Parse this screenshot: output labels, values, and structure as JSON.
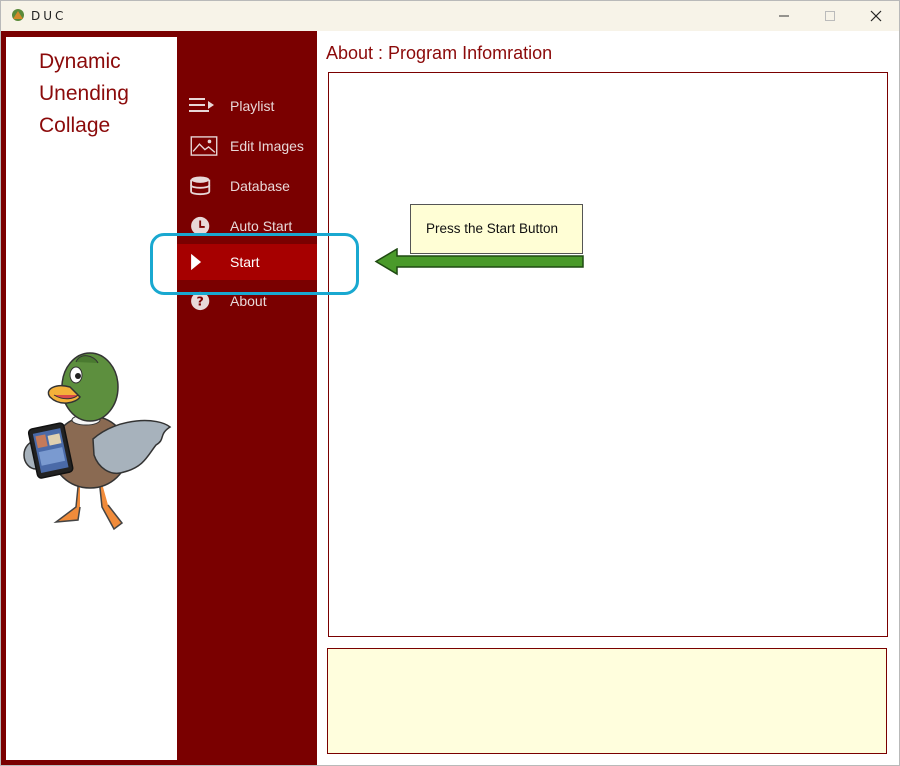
{
  "window": {
    "title": "DUC",
    "controls": {
      "minimize": "minimize-icon",
      "maximize": "maximize-icon",
      "close": "close-icon"
    }
  },
  "brand": {
    "line1": "Dynamic",
    "line2": "Unending",
    "line3": "Collage",
    "mascot": "duck-holding-tablet-illustration"
  },
  "nav": {
    "items": [
      {
        "label": "Playlist",
        "icon": "playlist-icon"
      },
      {
        "label": "Edit Images",
        "icon": "image-icon"
      },
      {
        "label": "Database",
        "icon": "database-icon"
      },
      {
        "label": "Auto Start",
        "icon": "clock-icon"
      },
      {
        "label": "Start",
        "icon": "play-icon",
        "active": true
      },
      {
        "label": "About",
        "icon": "question-icon"
      }
    ]
  },
  "content": {
    "title": "About : Program Infomration",
    "info_text": "",
    "status_text": ""
  },
  "annotation": {
    "callout": "Press the Start Button",
    "arrow_color": "#4a9a2a",
    "ring_color": "#19a8d0"
  },
  "colors": {
    "nav_bg": "#7a0000",
    "nav_active": "#a60000",
    "brand_text": "#8b0a0a",
    "status_bg": "#fffedd"
  }
}
